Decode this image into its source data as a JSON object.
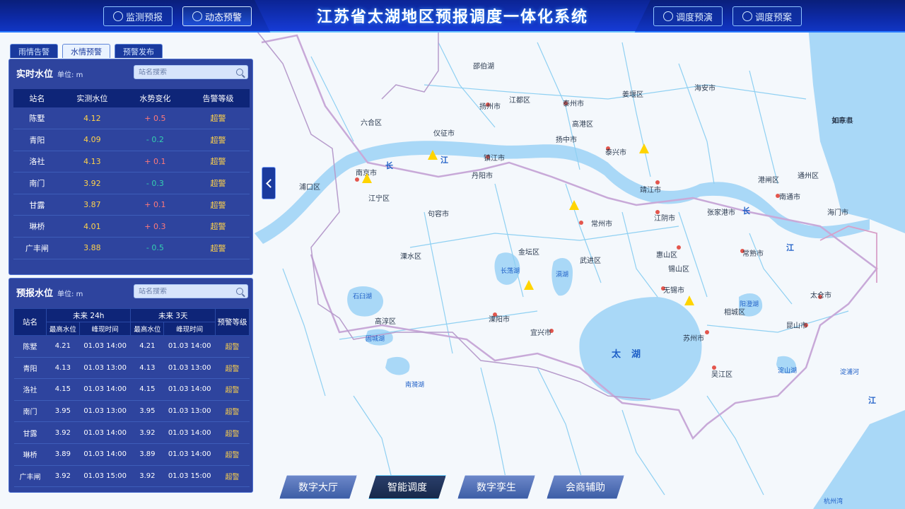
{
  "header": {
    "title": "江苏省太湖地区预报调度一体化系统",
    "nav_left": [
      "监测预报",
      "动态预警"
    ],
    "nav_right": [
      "调度预演",
      "调度预案"
    ],
    "active_nav": "动态预警"
  },
  "tabs": [
    "雨情告警",
    "水情预警",
    "预警发布"
  ],
  "active_tab": "水情预警",
  "realtime": {
    "title": "实时水位",
    "unit": "单位: m",
    "search_placeholder": "站名搜索",
    "columns": [
      "站名",
      "实测水位",
      "水势变化",
      "告警等级"
    ],
    "rows": [
      {
        "name": "陈墅",
        "level": "4.12",
        "change": "+ 0.5",
        "trend": "up",
        "alert": "超警"
      },
      {
        "name": "青阳",
        "level": "4.09",
        "change": "- 0.2",
        "trend": "down",
        "alert": "超警"
      },
      {
        "name": "洛社",
        "level": "4.13",
        "change": "+ 0.1",
        "trend": "up",
        "alert": "超警"
      },
      {
        "name": "南门",
        "level": "3.92",
        "change": "- 0.3",
        "trend": "down",
        "alert": "超警"
      },
      {
        "name": "甘露",
        "level": "3.87",
        "change": "+ 0.1",
        "trend": "up",
        "alert": "超警"
      },
      {
        "name": "琳桥",
        "level": "4.01",
        "change": "+ 0.3",
        "trend": "up",
        "alert": "超警"
      },
      {
        "name": "广丰闸",
        "level": "3.88",
        "change": "- 0.5",
        "trend": "down",
        "alert": "超警"
      }
    ]
  },
  "forecast": {
    "title": "预报水位",
    "unit": "单位: m",
    "search_placeholder": "站名搜索",
    "col_station": "站名",
    "group_24h": "未来 24h",
    "group_3d": "未来 3天",
    "col_level": "预警等级",
    "sub_max": "最高水位",
    "sub_time": "峰现时间",
    "rows": [
      {
        "name": "陈墅",
        "max24": "4.21",
        "t24": "01.03 14:00",
        "max3d": "4.21",
        "t3d": "01.03 14:00",
        "alert": "超警"
      },
      {
        "name": "青阳",
        "max24": "4.13",
        "t24": "01.03 13:00",
        "max3d": "4.13",
        "t3d": "01.03 13:00",
        "alert": "超警"
      },
      {
        "name": "洛社",
        "max24": "4.15",
        "t24": "01.03 14:00",
        "max3d": "4.15",
        "t3d": "01.03 14:00",
        "alert": "超警"
      },
      {
        "name": "南门",
        "max24": "3.95",
        "t24": "01.03 13:00",
        "max3d": "3.95",
        "t3d": "01.03 13:00",
        "alert": "超警"
      },
      {
        "name": "甘露",
        "max24": "3.92",
        "t24": "01.03 14:00",
        "max3d": "3.92",
        "t3d": "01.03 14:00",
        "alert": "超警"
      },
      {
        "name": "琳桥",
        "max24": "3.89",
        "t24": "01.03 14:00",
        "max3d": "3.89",
        "t3d": "01.03 14:00",
        "alert": "超警"
      },
      {
        "name": "广丰闸",
        "max24": "3.92",
        "t24": "01.03 15:00",
        "max3d": "3.92",
        "t3d": "01.03 15:00",
        "alert": "超警"
      }
    ]
  },
  "bottom_nav": [
    "数字大厅",
    "智能调度",
    "数字孪生",
    "会商辅助"
  ],
  "active_bottom": "智能调度",
  "colors": {
    "alert_yellow": "#ffd24a",
    "rise_red": "#ff7a7a",
    "fall_green": "#34d0b0",
    "panel_blue": "#1c3496",
    "water": "#a9d8f7"
  },
  "map": {
    "labels": [
      {
        "t": "扬州市"
      },
      {
        "t": "泰州市"
      },
      {
        "t": "镇江市"
      },
      {
        "t": "南京市"
      },
      {
        "t": "常州市"
      },
      {
        "t": "无锡市"
      },
      {
        "t": "苏州市"
      },
      {
        "t": "南通市"
      },
      {
        "t": "江阴市"
      },
      {
        "t": "张家港市"
      },
      {
        "t": "常熟市"
      },
      {
        "t": "太仓市"
      },
      {
        "t": "昆山市"
      },
      {
        "t": "吴江区"
      },
      {
        "t": "宜兴市"
      },
      {
        "t": "溧阳市"
      },
      {
        "t": "金坛区"
      },
      {
        "t": "武进区"
      },
      {
        "t": "丹阳市"
      },
      {
        "t": "句容市"
      },
      {
        "t": "江宁区"
      },
      {
        "t": "溧水区"
      },
      {
        "t": "高淳区"
      },
      {
        "t": "浦口区"
      },
      {
        "t": "六合区"
      },
      {
        "t": "仪征市"
      },
      {
        "t": "江都区"
      },
      {
        "t": "高港区"
      },
      {
        "t": "泰兴市"
      },
      {
        "t": "靖江市"
      },
      {
        "t": "如皋市"
      },
      {
        "t": "海门市"
      },
      {
        "t": "通州区"
      },
      {
        "t": "锡山区"
      },
      {
        "t": "惠山区"
      },
      {
        "t": "相城区"
      },
      {
        "t": "扬中市"
      },
      {
        "t": "如东县"
      },
      {
        "t": "海安市"
      },
      {
        "t": "姜堰区"
      },
      {
        "t": "邵伯湖"
      },
      {
        "t": "港闸区"
      }
    ],
    "rivers": [
      {
        "t": "长"
      },
      {
        "t": "江"
      },
      {
        "t": "太"
      },
      {
        "t": "湖"
      },
      {
        "t": "长"
      },
      {
        "t": "江"
      },
      {
        "t": "长荡湖"
      },
      {
        "t": "滆湖"
      },
      {
        "t": "石臼湖"
      },
      {
        "t": "固城湖"
      },
      {
        "t": "阳澄湖"
      },
      {
        "t": "淀山湖"
      },
      {
        "t": "南漪湖"
      },
      {
        "t": "淀浦河"
      },
      {
        "t": "杭州湾"
      },
      {
        "t": "江"
      }
    ],
    "warning_markers": [
      "warn",
      "warn",
      "warn",
      "warn",
      "warn",
      "warn",
      "warn"
    ]
  }
}
